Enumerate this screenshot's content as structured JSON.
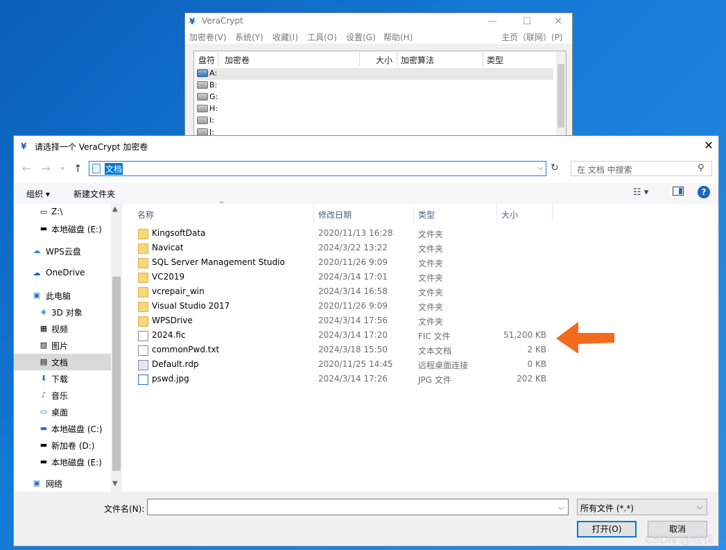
{
  "vc": {
    "title": "VeraCrypt",
    "menus": [
      "加密卷(V)",
      "系统(Y)",
      "收藏(I)",
      "工具(O)",
      "设置(G)",
      "帮助(H)"
    ],
    "menu_right": "主页（联网）(P)",
    "columns": [
      "盘符",
      "加密卷",
      "大小",
      "加密算法",
      "类型"
    ],
    "drives": [
      "A:",
      "B:",
      "G:",
      "H:",
      "I:",
      "J:"
    ]
  },
  "dialog": {
    "title": "请选择一个 VeraCrypt 加密卷",
    "address": "文档",
    "search_placeholder": "在 文档 中搜索",
    "organize": "组织 ▾",
    "new_folder": "新建文件夹"
  },
  "nav": [
    {
      "label": "Z:\\",
      "icon": "network-drive-icon"
    },
    {
      "label": "本地磁盘 (E:)",
      "icon": "drive-icon"
    },
    {
      "label": "WPS云盘",
      "icon": "cloud-icon"
    },
    {
      "label": "OneDrive",
      "icon": "onedrive-icon"
    },
    {
      "label": "此电脑",
      "icon": "computer-icon"
    },
    {
      "label": "3D 对象",
      "icon": "3d-objects-icon"
    },
    {
      "label": "视频",
      "icon": "video-icon"
    },
    {
      "label": "图片",
      "icon": "pictures-icon"
    },
    {
      "label": "文档",
      "icon": "documents-icon"
    },
    {
      "label": "下载",
      "icon": "download-icon"
    },
    {
      "label": "音乐",
      "icon": "music-icon"
    },
    {
      "label": "桌面",
      "icon": "desktop-icon"
    },
    {
      "label": "本地磁盘 (C:)",
      "icon": "drive-icon"
    },
    {
      "label": "新加卷 (D:)",
      "icon": "drive-icon"
    },
    {
      "label": "本地磁盘 (E:)",
      "icon": "drive-icon"
    },
    {
      "label": "网络",
      "icon": "network-icon"
    }
  ],
  "columns": {
    "name": "名称",
    "modified": "修改日期",
    "type": "类型",
    "size": "大小"
  },
  "files": [
    {
      "name": "KingsoftData",
      "modified": "2020/11/13 16:28",
      "type": "文件夹",
      "size": "",
      "kind": "folder"
    },
    {
      "name": "Navicat",
      "modified": "2024/3/22 13:22",
      "type": "文件夹",
      "size": "",
      "kind": "folder"
    },
    {
      "name": "SQL Server Management Studio",
      "modified": "2020/11/26 9:09",
      "type": "文件夹",
      "size": "",
      "kind": "folder"
    },
    {
      "name": "VC2019",
      "modified": "2024/3/14 17:01",
      "type": "文件夹",
      "size": "",
      "kind": "folder"
    },
    {
      "name": "vcrepair_win",
      "modified": "2024/3/14 16:58",
      "type": "文件夹",
      "size": "",
      "kind": "folder"
    },
    {
      "name": "Visual Studio 2017",
      "modified": "2020/11/26 9:09",
      "type": "文件夹",
      "size": "",
      "kind": "folder"
    },
    {
      "name": "WPSDrive",
      "modified": "2024/3/14 17:56",
      "type": "文件夹",
      "size": "",
      "kind": "folder"
    },
    {
      "name": "2024.fic",
      "modified": "2024/3/14 17:20",
      "type": "FIC 文件",
      "size": "51,200 KB",
      "kind": "file"
    },
    {
      "name": "commonPwd.txt",
      "modified": "2024/3/18 15:50",
      "type": "文本文档",
      "size": "2 KB",
      "kind": "file"
    },
    {
      "name": "Default.rdp",
      "modified": "2020/11/25 14:45",
      "type": "远程桌面连接",
      "size": "0 KB",
      "kind": "file"
    },
    {
      "name": "pswd.jpg",
      "modified": "2024/3/14 17:26",
      "type": "JPG 文件",
      "size": "202 KB",
      "kind": "file"
    }
  ],
  "footer": {
    "filename_label": "文件名(N):",
    "filename_value": "",
    "filter": "所有文件 (*.*)",
    "open": "打开(O)",
    "cancel": "取消"
  },
  "watermark": "CSDN @晓衣",
  "colors": {
    "accent": "#0078d7",
    "annotation_arrow": "#f26a1b",
    "folder": "#f8d775"
  }
}
